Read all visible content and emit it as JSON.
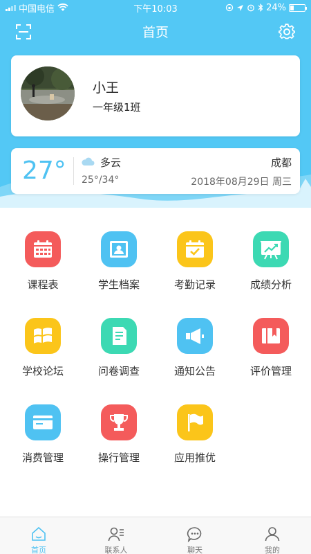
{
  "status_bar": {
    "carrier": "中国电信",
    "time": "下午10:03",
    "battery": "24%",
    "battery_level": 0.24
  },
  "nav": {
    "title": "首页"
  },
  "profile": {
    "name": "小王",
    "class": "一年级1班"
  },
  "weather": {
    "temperature": "27°",
    "condition": "多云",
    "range": "25°/34°",
    "city": "成都",
    "date": "2018年08月29日 周三"
  },
  "apps": [
    {
      "label": "课程表",
      "icon": "calendar-grid-icon",
      "color": "#f45b5b"
    },
    {
      "label": "学生档案",
      "icon": "student-profile-icon",
      "color": "#4fc2f2"
    },
    {
      "label": "考勤记录",
      "icon": "attendance-check-icon",
      "color": "#fbc51a"
    },
    {
      "label": "成绩分析",
      "icon": "chart-board-icon",
      "color": "#3cd9b3"
    },
    {
      "label": "学校论坛",
      "icon": "forum-windows-icon",
      "color": "#fbc51a"
    },
    {
      "label": "问卷调查",
      "icon": "questionnaire-icon",
      "color": "#3cd9b3"
    },
    {
      "label": "通知公告",
      "icon": "megaphone-icon",
      "color": "#4fc2f2"
    },
    {
      "label": "评价管理",
      "icon": "book-bookmark-icon",
      "color": "#f45b5b"
    },
    {
      "label": "消费管理",
      "icon": "card-icon",
      "color": "#4fc2f2"
    },
    {
      "label": "操行管理",
      "icon": "trophy-icon",
      "color": "#f45b5b"
    },
    {
      "label": "应用推优",
      "icon": "flag-icon",
      "color": "#fbc51a"
    }
  ],
  "tabs": [
    {
      "label": "首页",
      "icon": "home-icon",
      "active": true
    },
    {
      "label": "联系人",
      "icon": "contacts-icon",
      "active": false
    },
    {
      "label": "聊天",
      "icon": "chat-bubble-icon",
      "active": false
    },
    {
      "label": "我的",
      "icon": "user-icon",
      "active": false
    }
  ],
  "colors": {
    "accent": "#53c8f5",
    "active_tab": "#4fc2f2"
  }
}
